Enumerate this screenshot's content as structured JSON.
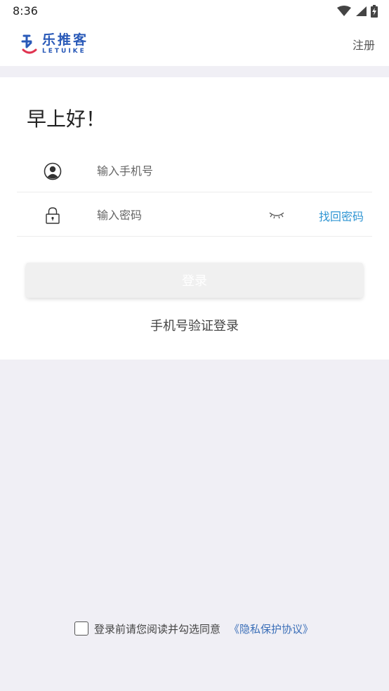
{
  "status_bar": {
    "time": "8:36",
    "icons": [
      "wifi-icon",
      "cellular-signal-icon",
      "battery-charging-icon"
    ]
  },
  "header": {
    "logo_text_cn": "乐推客",
    "logo_text_en": "LETUIKE",
    "register_label": "注册"
  },
  "login_form": {
    "greeting": "早上好！",
    "phone": {
      "placeholder": "输入手机号",
      "value": "",
      "icon": "user-icon"
    },
    "password": {
      "placeholder": "输入密码",
      "value": "",
      "icon": "lock-icon",
      "toggle_icon": "eye-closed-icon"
    },
    "forgot_password_label": "找回密码",
    "login_button_label": "登录",
    "sms_login_label": "手机号验证登录"
  },
  "agreement": {
    "checked": false,
    "text": "登录前请您阅读并勾选同意",
    "privacy_link": "《隐私保护协议》"
  },
  "colors": {
    "brand_blue": "#2a5ab8",
    "link_blue": "#2f95d3",
    "privacy_blue": "#3b6fb8",
    "logo_red": "#e0334f",
    "page_background": "#f0eff5"
  }
}
